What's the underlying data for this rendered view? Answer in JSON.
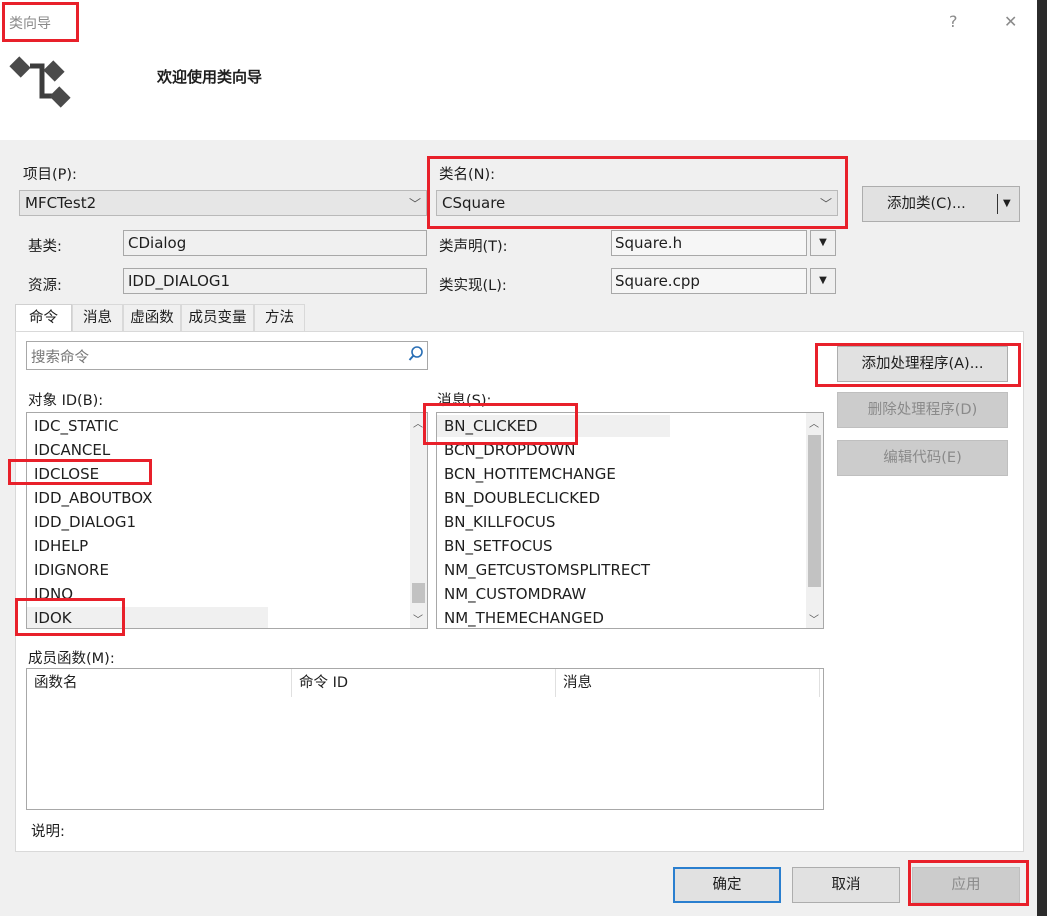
{
  "window": {
    "title": "类向导",
    "help_glyph": "?",
    "close_glyph": "✕"
  },
  "header": {
    "welcome": "欢迎使用类向导",
    "icon": "class-wizard-icon"
  },
  "project": {
    "label": "项目(P):",
    "value": "MFCTest2"
  },
  "classname": {
    "label": "类名(N):",
    "value": "CSquare"
  },
  "add_class_button": "添加类(C)...",
  "base_class": {
    "label": "基类:",
    "value": "CDialog"
  },
  "resource": {
    "label": "资源:",
    "value": "IDD_DIALOG1"
  },
  "class_decl": {
    "label": "类声明(T):",
    "value": "Square.h"
  },
  "class_impl": {
    "label": "类实现(L):",
    "value": "Square.cpp"
  },
  "tabs": [
    "命令",
    "消息",
    "虚函数",
    "成员变量",
    "方法"
  ],
  "active_tab": "命令",
  "search": {
    "placeholder": "搜索命令"
  },
  "object_ids": {
    "label": "对象 ID(B):",
    "items": [
      "IDC_STATIC",
      "IDCANCEL",
      "IDCLOSE",
      "IDD_ABOUTBOX",
      "IDD_DIALOG1",
      "IDHELP",
      "IDIGNORE",
      "IDNO",
      "IDOK"
    ],
    "selected": "IDOK"
  },
  "messages": {
    "label": "消息(S):",
    "items": [
      "BN_CLICKED",
      "BCN_DROPDOWN",
      "BCN_HOTITEMCHANGE",
      "BN_DOUBLECLICKED",
      "BN_KILLFOCUS",
      "BN_SETFOCUS",
      "NM_GETCUSTOMSPLITRECT",
      "NM_CUSTOMDRAW",
      "NM_THEMECHANGED"
    ],
    "selected": "BN_CLICKED"
  },
  "handler_buttons": {
    "add": "添加处理程序(A)...",
    "delete": "删除处理程序(D)",
    "edit": "编辑代码(E)"
  },
  "member_functions": {
    "label": "成员函数(M):",
    "columns": [
      "函数名",
      "命令 ID",
      "消息"
    ]
  },
  "description": {
    "label": "说明:"
  },
  "footer": {
    "ok": "确定",
    "cancel": "取消",
    "apply": "应用"
  },
  "colors": {
    "highlight_box": "#e8202a",
    "default_button_border": "#2a7fcf"
  }
}
